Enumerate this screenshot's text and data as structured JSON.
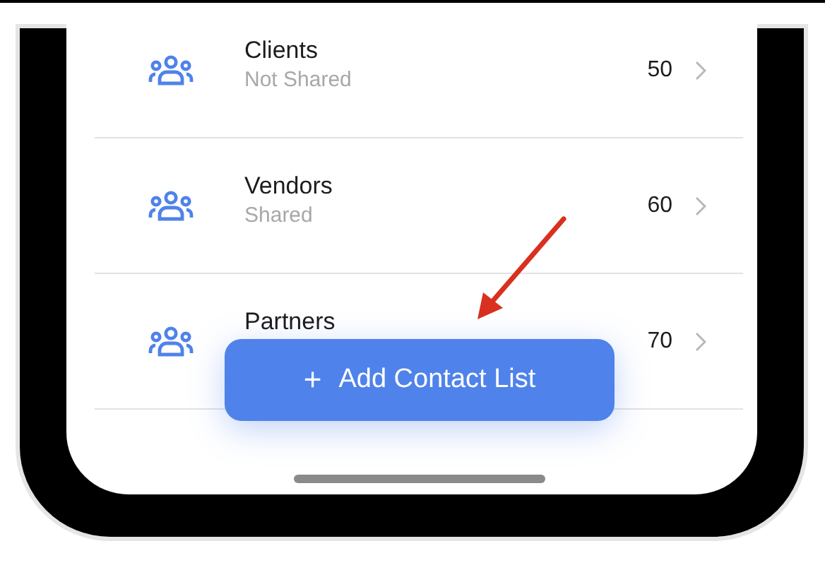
{
  "contact_lists": [
    {
      "name": "Clients",
      "sharing": "Not Shared",
      "count": "50"
    },
    {
      "name": "Vendors",
      "sharing": "Shared",
      "count": "60"
    },
    {
      "name": "Partners",
      "count": "70"
    }
  ],
  "add_button": {
    "icon": "+",
    "label": "Add Contact List"
  }
}
